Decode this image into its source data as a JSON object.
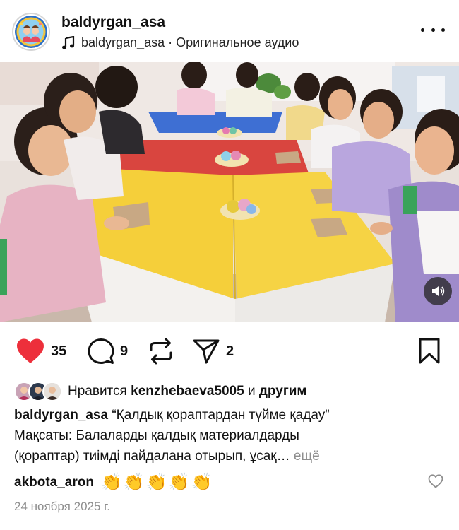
{
  "header": {
    "username": "baldyrgan_asa",
    "audio_user": "baldyrgan_asa",
    "audio_separator": " · ",
    "audio_label": "Оригинальное аудио"
  },
  "actions": {
    "likes_count": "35",
    "comments_count": "9",
    "shares_count": "2"
  },
  "likes_row": {
    "prefix": "Нравится ",
    "user": "kenzhebaeva5005",
    "middle": " и ",
    "suffix": "другим"
  },
  "caption": {
    "user": "baldyrgan_asa",
    "title": " “Қалдық қораптардан түйме қадау”",
    "line2": "Мақсаты: Балаларды қалдық материалдарды",
    "line3": "(қораптар) тиімді пайдалана отырып, ұсақ…",
    "more_label": " ещё"
  },
  "comment": {
    "user": "akbota_aron",
    "text": "👏👏👏👏👏"
  },
  "date": "24 ноября 2025 г.",
  "colors": {
    "like_red": "#ed2f3b",
    "table_yellow": "#f5cf3a",
    "table_red": "#d9453f",
    "table_blue": "#3e6fd3"
  }
}
